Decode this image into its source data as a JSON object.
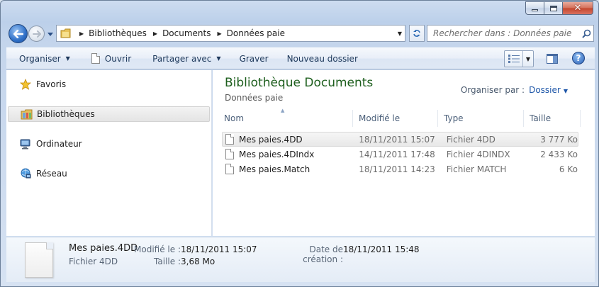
{
  "window": {
    "title": "Données paie"
  },
  "nav": {
    "breadcrumbs": [
      "Bibliothèques",
      "Documents",
      "Données paie"
    ],
    "search_placeholder": "Rechercher dans : Données paie"
  },
  "toolbar": {
    "organize": "Organiser",
    "open": "Ouvrir",
    "share": "Partager avec",
    "burn": "Graver",
    "new_folder": "Nouveau dossier",
    "help": "?"
  },
  "sidebar": {
    "items": [
      {
        "label": "Favoris",
        "icon": "star-icon"
      },
      {
        "label": "Bibliothèques",
        "icon": "libraries-icon",
        "selected": true
      },
      {
        "label": "Ordinateur",
        "icon": "computer-icon"
      },
      {
        "label": "Réseau",
        "icon": "network-icon"
      }
    ]
  },
  "content": {
    "title": "Bibliothèque Documents",
    "subtitle": "Données paie",
    "arrange_label": "Organiser par :",
    "arrange_value": "Dossier",
    "columns": {
      "name": "Nom",
      "modified": "Modifié le",
      "type": "Type",
      "size": "Taille"
    },
    "files": [
      {
        "name": "Mes paies.4DD",
        "modified": "18/11/2011 15:07",
        "type": "Fichier 4DD",
        "size": "3 777 Ko",
        "selected": true
      },
      {
        "name": "Mes paies.4DIndx",
        "modified": "14/11/2011 17:48",
        "type": "Fichier 4DINDX",
        "size": "2 433 Ko"
      },
      {
        "name": "Mes paies.Match",
        "modified": "18/11/2011 14:23",
        "type": "Fichier MATCH",
        "size": "6 Ko"
      }
    ]
  },
  "details": {
    "name": "Mes paies.4DD",
    "type": "Fichier 4DD",
    "modified_label": "Modifié le :",
    "modified_value": "18/11/2011 15:07",
    "size_label": "Taille :",
    "size_value": "3,68 Mo",
    "created_label": "Date de création :",
    "created_value": "18/11/2011 15:48"
  },
  "colors": {
    "library_title": "#1e5f1e",
    "link_blue": "#1d56a8"
  }
}
